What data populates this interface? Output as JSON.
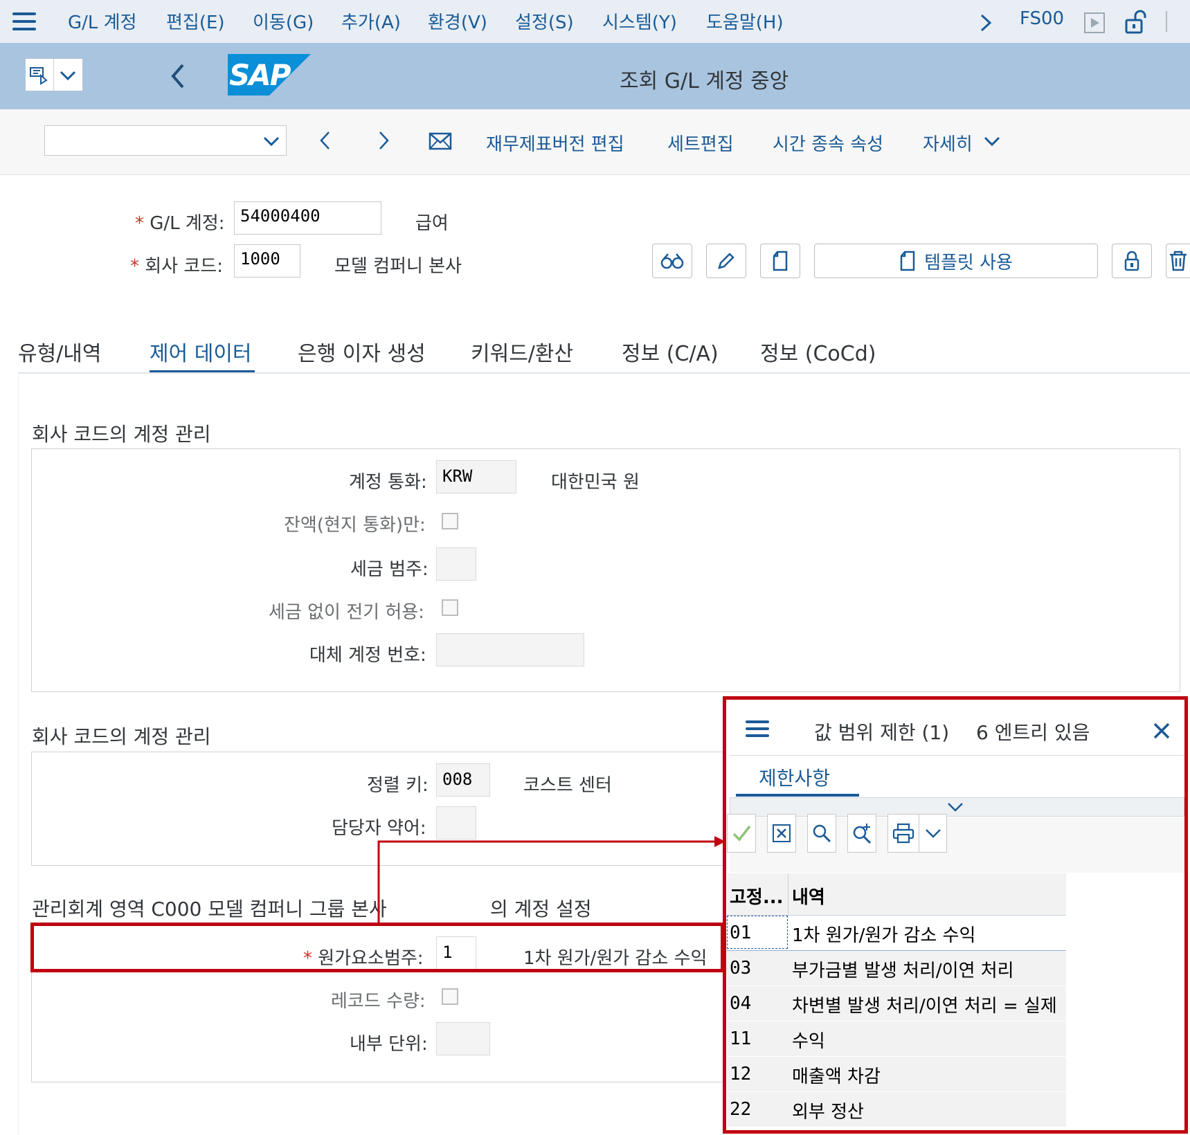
{
  "menubar": {
    "items": [
      "G/L 계정",
      "편집(E)",
      "이동(G)",
      "추가(A)",
      "환경(V)",
      "설정(S)",
      "시스템(Y)",
      "도움말(H)"
    ],
    "tcode": "FS00"
  },
  "header": {
    "title": "조회 G/L 계정 중앙",
    "logo": "SAP"
  },
  "toolbar": {
    "dropdown_value": "",
    "links": [
      "재무제표버전 편집",
      "세트편집",
      "시간 종속 속성",
      "자세히"
    ]
  },
  "form": {
    "gl_account_label": "G/L 계정:",
    "gl_account_value": "54000400",
    "gl_account_desc": "급여",
    "company_code_label": "회사 코드:",
    "company_code_value": "1000",
    "company_code_desc": "모델 컴퍼니 본사",
    "template_button": "템플릿 사용"
  },
  "tabs": [
    "유형/내역",
    "제어 데이터",
    "은행 이자 생성",
    "키워드/환산",
    "정보 (C/A)",
    "정보 (CoCd)"
  ],
  "active_tab": "제어 데이터",
  "section1": {
    "title": "회사 코드의 계정 관리",
    "currency_label": "계정 통화:",
    "currency_value": "KRW",
    "currency_desc": "대한민국 원",
    "balance_local_label": "잔액(현지 통화)만:",
    "tax_category_label": "세금 범주:",
    "post_without_tax_label": "세금 없이 전기 허용:",
    "alt_account_label": "대체 계정 번호:"
  },
  "section2": {
    "title": "회사 코드의 계정 관리",
    "sort_key_label": "정렬 키:",
    "sort_key_value": "008",
    "sort_key_desc": "코스트 센터",
    "clerk_label": "담당자 약어:"
  },
  "section3": {
    "title": "관리회계 영역 C000 모델 컴퍼니 그룹 본사",
    "title_suffix": "의 계정 설정",
    "cost_element_label": "원가요소범주:",
    "cost_element_value": "1",
    "cost_element_desc": "1차 원가/원가 감소 수익",
    "record_qty_label": "레코드 수량:",
    "internal_uom_label": "내부 단위:"
  },
  "popup": {
    "title": "값 범위 제한 (1)",
    "entries": "6 엔트리 있음",
    "tab": "제한사항",
    "col_fixed": "고정...",
    "col_desc": "내역",
    "rows": [
      {
        "key": "01",
        "desc": "1차 원가/원가 감소 수익"
      },
      {
        "key": "03",
        "desc": "부가금별 발생 처리/이연 처리"
      },
      {
        "key": "04",
        "desc": "차변별 발생 처리/이연 처리 = 실제"
      },
      {
        "key": "11",
        "desc": "수익"
      },
      {
        "key": "12",
        "desc": "매출액 차감"
      },
      {
        "key": "22",
        "desc": "외부 정산"
      }
    ]
  },
  "colors": {
    "accent": "#1a5a96",
    "highlight": "#c00010",
    "header_bg": "#a9c4df"
  }
}
